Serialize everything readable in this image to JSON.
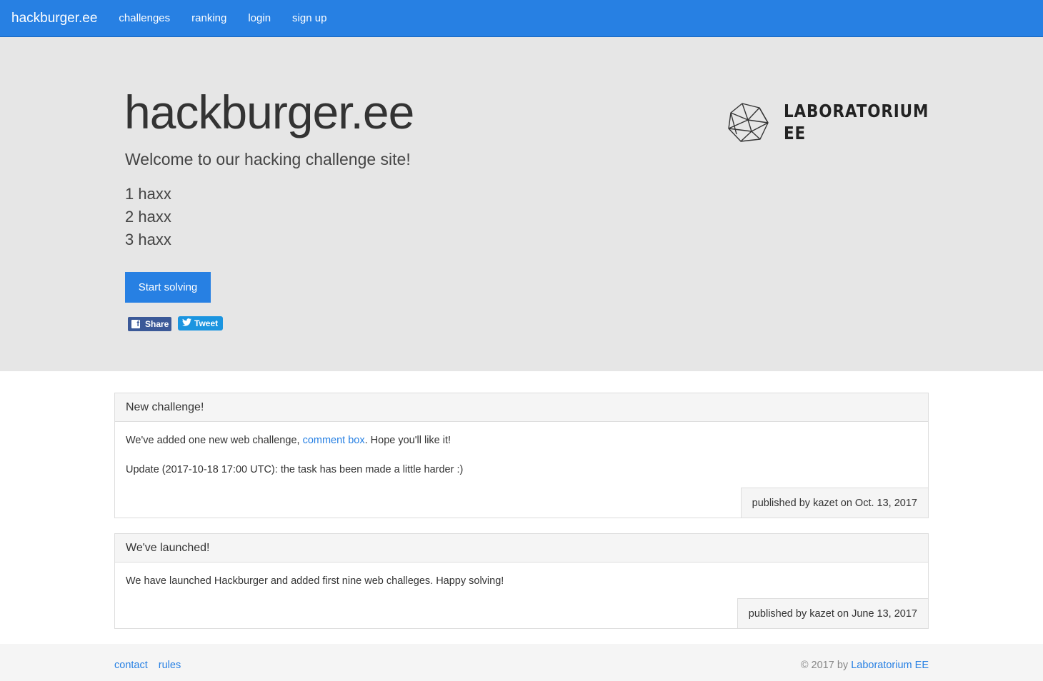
{
  "navbar": {
    "brand": "hackburger.ee",
    "links": [
      "challenges",
      "ranking",
      "login",
      "sign up"
    ]
  },
  "hero": {
    "title": "hackburger.ee",
    "subtitle": "Welcome to our hacking challenge site!",
    "lines": [
      "1 haxx",
      "2 haxx",
      "3 haxx"
    ],
    "cta_label": "Start solving",
    "share_label": "Share",
    "tweet_label": "Tweet",
    "logo_line1": "LABORATORIUM",
    "logo_line2": "EE"
  },
  "posts": [
    {
      "title": "New challenge!",
      "body1_before": "We've added one new web challenge, ",
      "body1_link": "comment box",
      "body1_after": ". Hope you'll like it!",
      "body2": "Update (2017-10-18 17:00 UTC): the task has been made a little harder :)",
      "footer": "published by kazet on Oct. 13, 2017"
    },
    {
      "title": "We've launched!",
      "body1": "We have launched Hackburger and added first nine web challeges. Happy solving!",
      "footer": "published by kazet on June 13, 2017"
    }
  ],
  "footer": {
    "links": [
      "contact",
      "rules"
    ],
    "copyright_prefix": "© 2017 by ",
    "copyright_link": "Laboratorium EE"
  },
  "colors": {
    "primary": "#2780e3",
    "jumbotron_bg": "#e6e6e6",
    "facebook": "#3b5998",
    "twitter": "#1b95e0"
  }
}
